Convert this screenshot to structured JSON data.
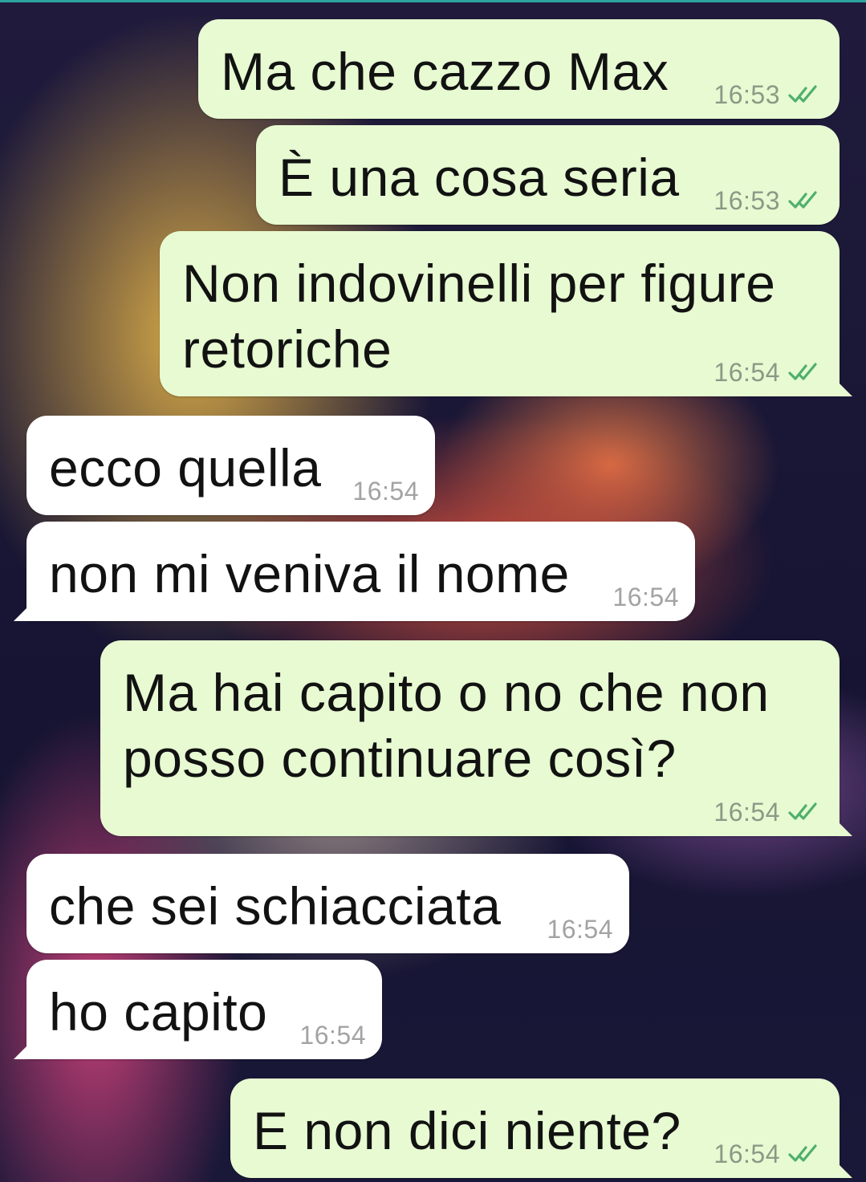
{
  "messages": [
    {
      "direction": "out",
      "text": "Ma che cazzo Max",
      "time": "16:53",
      "read": true
    },
    {
      "direction": "out",
      "text": "È una cosa seria",
      "time": "16:53",
      "read": true
    },
    {
      "direction": "out",
      "text": "Non indovinelli per figure\nretoriche",
      "time": "16:54",
      "read": true
    },
    {
      "direction": "in",
      "text": "ecco quella",
      "time": "16:54"
    },
    {
      "direction": "in",
      "text": "non mi veniva il nome",
      "time": "16:54"
    },
    {
      "direction": "out",
      "text": "Ma hai capito o no che non\nposso continuare così?",
      "time": "16:54",
      "read": true
    },
    {
      "direction": "in",
      "text": "che sei schiacciata",
      "time": "16:54"
    },
    {
      "direction": "in",
      "text": "ho capito",
      "time": "16:54"
    },
    {
      "direction": "out",
      "text": "E non dici niente?",
      "time": "16:54",
      "read": true
    }
  ],
  "colors": {
    "outgoing_bubble": "#e7fad2",
    "incoming_bubble": "#ffffff",
    "read_check": "#4fb06a"
  },
  "icons": {
    "read_receipt": "double-check-icon"
  }
}
